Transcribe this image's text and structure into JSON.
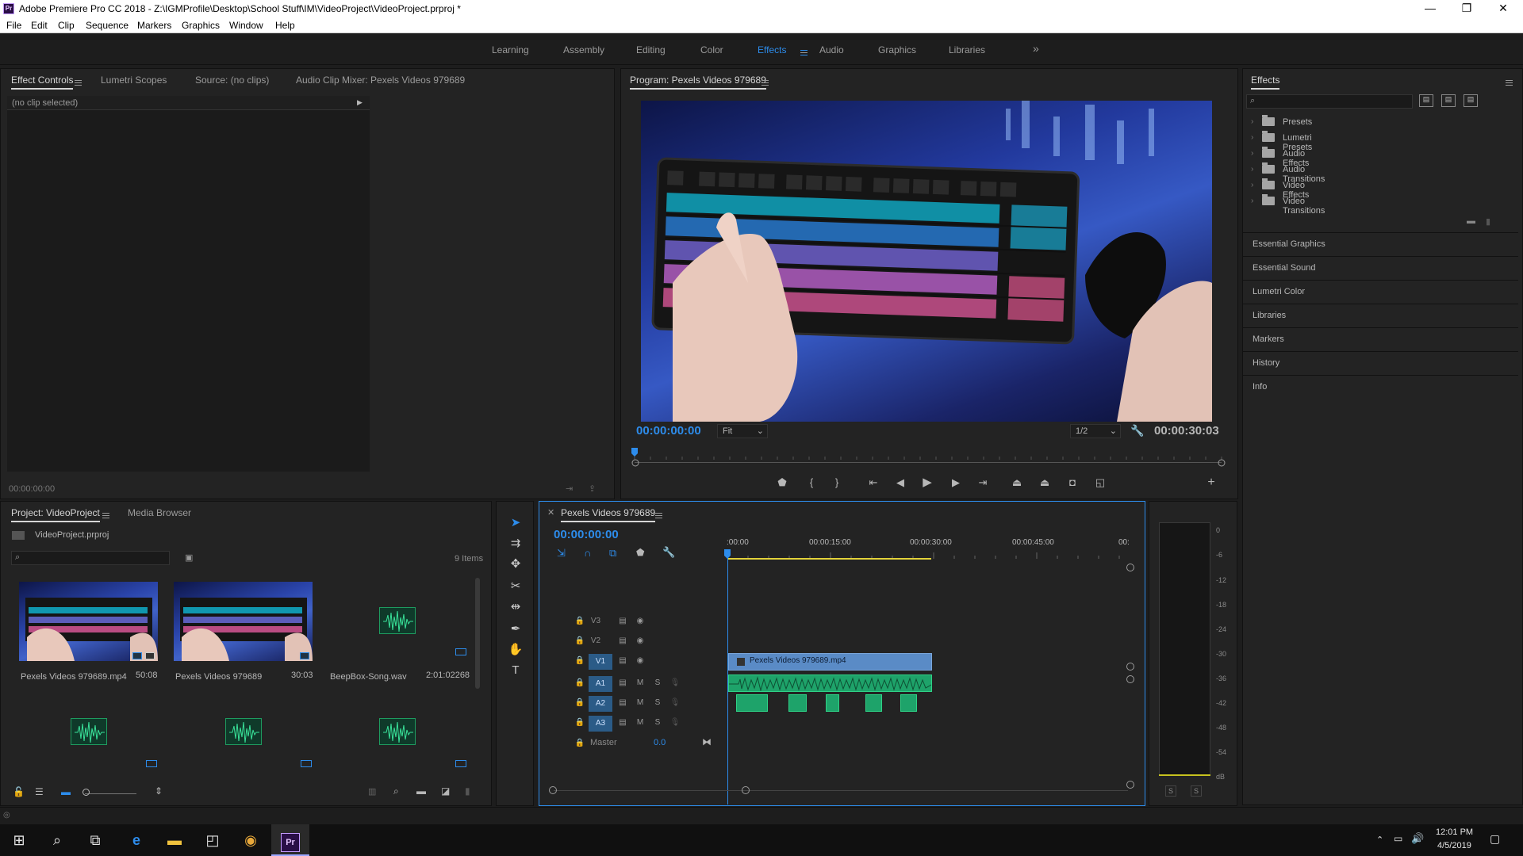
{
  "window": {
    "title": "Adobe Premiere Pro CC 2018 - Z:\\IGMProfile\\Desktop\\School Stuff\\IM\\VideoProject\\VideoProject.prproj *",
    "app_icon_text": "Pr",
    "minimize": "—",
    "maximize": "❐",
    "close": "✕"
  },
  "menu": [
    "File",
    "Edit",
    "Clip",
    "Sequence",
    "Markers",
    "Graphics",
    "Window",
    "Help"
  ],
  "workspaces": {
    "tabs": [
      "Learning",
      "Assembly",
      "Editing",
      "Color",
      "Effects",
      "Audio",
      "Graphics",
      "Libraries"
    ],
    "active": "Effects",
    "overflow": "»"
  },
  "effect_controls": {
    "tabs": [
      "Effect Controls",
      "Lumetri Scopes",
      "Source: (no clips)",
      "Audio Clip Mixer: Pexels Videos 979689"
    ],
    "no_clip": "(no clip selected)",
    "timecode": "00:00:00:00"
  },
  "program_monitor": {
    "tab": "Program: Pexels Videos 979689",
    "timecode_current": "00:00:00:00",
    "fit": "Fit",
    "resolution": "1/2",
    "timecode_duration": "00:00:30:03"
  },
  "effects_panel": {
    "title": "Effects",
    "search_placeholder": "",
    "folders": [
      "Presets",
      "Lumetri Presets",
      "Audio Effects",
      "Audio Transitions",
      "Video Effects",
      "Video Transitions"
    ],
    "side_panels": [
      "Essential Graphics",
      "Essential Sound",
      "Lumetri Color",
      "Libraries",
      "Markers",
      "History",
      "Info"
    ]
  },
  "project": {
    "tabs": [
      "Project: VideoProject",
      "Media Browser"
    ],
    "file": "VideoProject.prproj",
    "count": "9 Items",
    "items": [
      {
        "name": "Pexels Videos 979689.mp4",
        "duration": "50:08",
        "kind": "video"
      },
      {
        "name": "Pexels Videos 979689",
        "duration": "30:03",
        "kind": "video"
      },
      {
        "name": "BeepBox-Song.wav",
        "duration": "2:01:02268",
        "kind": "audio"
      },
      {
        "name": "",
        "duration": "",
        "kind": "audio"
      },
      {
        "name": "",
        "duration": "",
        "kind": "audio"
      },
      {
        "name": "",
        "duration": "",
        "kind": "audio"
      }
    ]
  },
  "timeline": {
    "tab": "Pexels Videos 979689",
    "timecode": "00:00:00:00",
    "ruler": [
      ":00:00",
      "00:00:15:00",
      "00:00:30:00",
      "00:00:45:00",
      "00:"
    ],
    "tracks": [
      {
        "id": "V3",
        "type": "video"
      },
      {
        "id": "V2",
        "type": "video"
      },
      {
        "id": "V1",
        "type": "video"
      },
      {
        "id": "A1",
        "type": "audio"
      },
      {
        "id": "A2",
        "type": "audio"
      },
      {
        "id": "A3",
        "type": "audio"
      }
    ],
    "master_label": "Master",
    "master_value": "0.0",
    "video_clip": "Pexels Videos 979689.mp4",
    "mute_label": "M",
    "solo_label": "S"
  },
  "meters": {
    "scale": [
      "0",
      "-6",
      "-12",
      "-18",
      "-24",
      "-30",
      "-36",
      "-42",
      "-48",
      "-54",
      "dB"
    ],
    "solo": [
      "S",
      "S"
    ]
  },
  "taskbar": {
    "time": "12:01 PM",
    "date": "4/5/2019"
  },
  "colors": {
    "accent": "#2d8ceb",
    "video_clip": "#5a8bc6",
    "audio_clip": "#1ea36a",
    "panel_bg": "#232323",
    "timeline_border": "#2d8ceb"
  }
}
